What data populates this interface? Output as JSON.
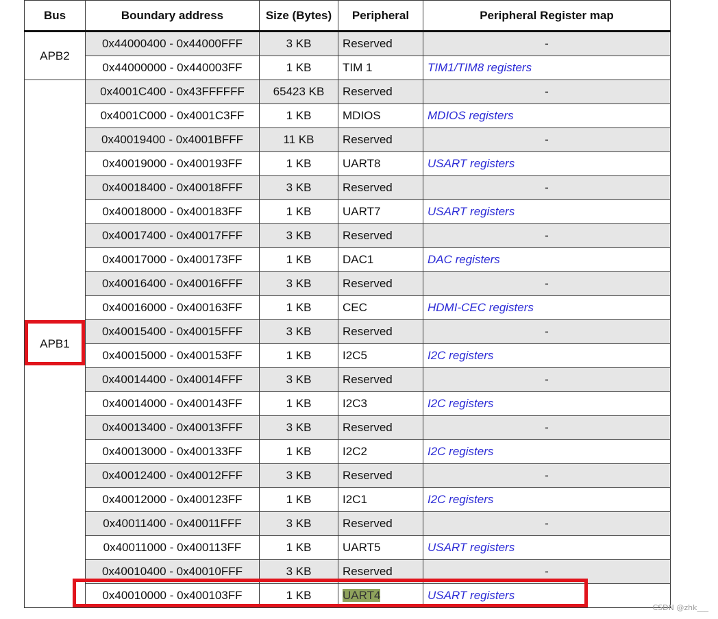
{
  "headers": {
    "bus": "Bus",
    "boundary": "Boundary address",
    "size": "Size (Bytes)",
    "peripheral": "Peripheral",
    "regmap": "Peripheral Register map"
  },
  "groups": [
    {
      "bus": "APB2",
      "rows": [
        {
          "addr": "0x44000400 - 0x44000FFF",
          "size": "3 KB",
          "peripheral": "Reserved",
          "regmap": "-"
        },
        {
          "addr": "0x44000000 - 0x440003FF",
          "size": "1 KB",
          "peripheral": "TIM 1",
          "regmap": "TIM1/TIM8 registers"
        }
      ]
    },
    {
      "bus": "APB1",
      "rows": [
        {
          "addr": "0x4001C400 - 0x43FFFFFF",
          "size": "65423 KB",
          "peripheral": "Reserved",
          "regmap": "-"
        },
        {
          "addr": "0x4001C000 - 0x4001C3FF",
          "size": "1 KB",
          "peripheral": "MDIOS",
          "regmap": "MDIOS registers"
        },
        {
          "addr": "0x40019400 - 0x4001BFFF",
          "size": "11 KB",
          "peripheral": "Reserved",
          "regmap": "-"
        },
        {
          "addr": "0x40019000 - 0x400193FF",
          "size": "1 KB",
          "peripheral": "UART8",
          "regmap": "USART registers"
        },
        {
          "addr": "0x40018400 - 0x40018FFF",
          "size": "3 KB",
          "peripheral": "Reserved",
          "regmap": "-"
        },
        {
          "addr": "0x40018000 - 0x400183FF",
          "size": "1 KB",
          "peripheral": "UART7",
          "regmap": "USART registers"
        },
        {
          "addr": "0x40017400 - 0x40017FFF",
          "size": "3 KB",
          "peripheral": "Reserved",
          "regmap": "-"
        },
        {
          "addr": "0x40017000 - 0x400173FF",
          "size": "1 KB",
          "peripheral": "DAC1",
          "regmap": "DAC registers"
        },
        {
          "addr": "0x40016400 - 0x40016FFF",
          "size": "3 KB",
          "peripheral": "Reserved",
          "regmap": "-"
        },
        {
          "addr": "0x40016000 - 0x400163FF",
          "size": "1 KB",
          "peripheral": "CEC",
          "regmap": "HDMI-CEC registers"
        },
        {
          "addr": "0x40015400 - 0x40015FFF",
          "size": "3 KB",
          "peripheral": "Reserved",
          "regmap": "-"
        },
        {
          "addr": "0x40015000 - 0x400153FF",
          "size": "1 KB",
          "peripheral": "I2C5",
          "regmap": "I2C registers"
        },
        {
          "addr": "0x40014400 - 0x40014FFF",
          "size": "3 KB",
          "peripheral": "Reserved",
          "regmap": "-"
        },
        {
          "addr": "0x40014000 - 0x400143FF",
          "size": "1 KB",
          "peripheral": "I2C3",
          "regmap": "I2C registers"
        },
        {
          "addr": "0x40013400 - 0x40013FFF",
          "size": "3 KB",
          "peripheral": "Reserved",
          "regmap": "-"
        },
        {
          "addr": "0x40013000 - 0x400133FF",
          "size": "1 KB",
          "peripheral": "I2C2",
          "regmap": "I2C registers"
        },
        {
          "addr": "0x40012400 - 0x40012FFF",
          "size": "3 KB",
          "peripheral": "Reserved",
          "regmap": "-"
        },
        {
          "addr": "0x40012000 - 0x400123FF",
          "size": "1 KB",
          "peripheral": "I2C1",
          "regmap": "I2C registers"
        },
        {
          "addr": "0x40011400 - 0x40011FFF",
          "size": "3 KB",
          "peripheral": "Reserved",
          "regmap": "-"
        },
        {
          "addr": "0x40011000 - 0x400113FF",
          "size": "1 KB",
          "peripheral": "UART5",
          "regmap": "USART registers"
        },
        {
          "addr": "0x40010400 - 0x40010FFF",
          "size": "3 KB",
          "peripheral": "Reserved",
          "regmap": "-"
        },
        {
          "addr": "0x40010000 - 0x400103FF",
          "size": "1 KB",
          "peripheral": "UART4",
          "regmap": "USART registers",
          "highlight": true
        }
      ]
    }
  ],
  "colors": {
    "annotation_red": "#e1141c",
    "reserved_row": "#e6e6e6",
    "link_blue": "#2b2bd6",
    "text_highlight": "#8fa35c"
  },
  "watermark": "CSDN @zhk___"
}
